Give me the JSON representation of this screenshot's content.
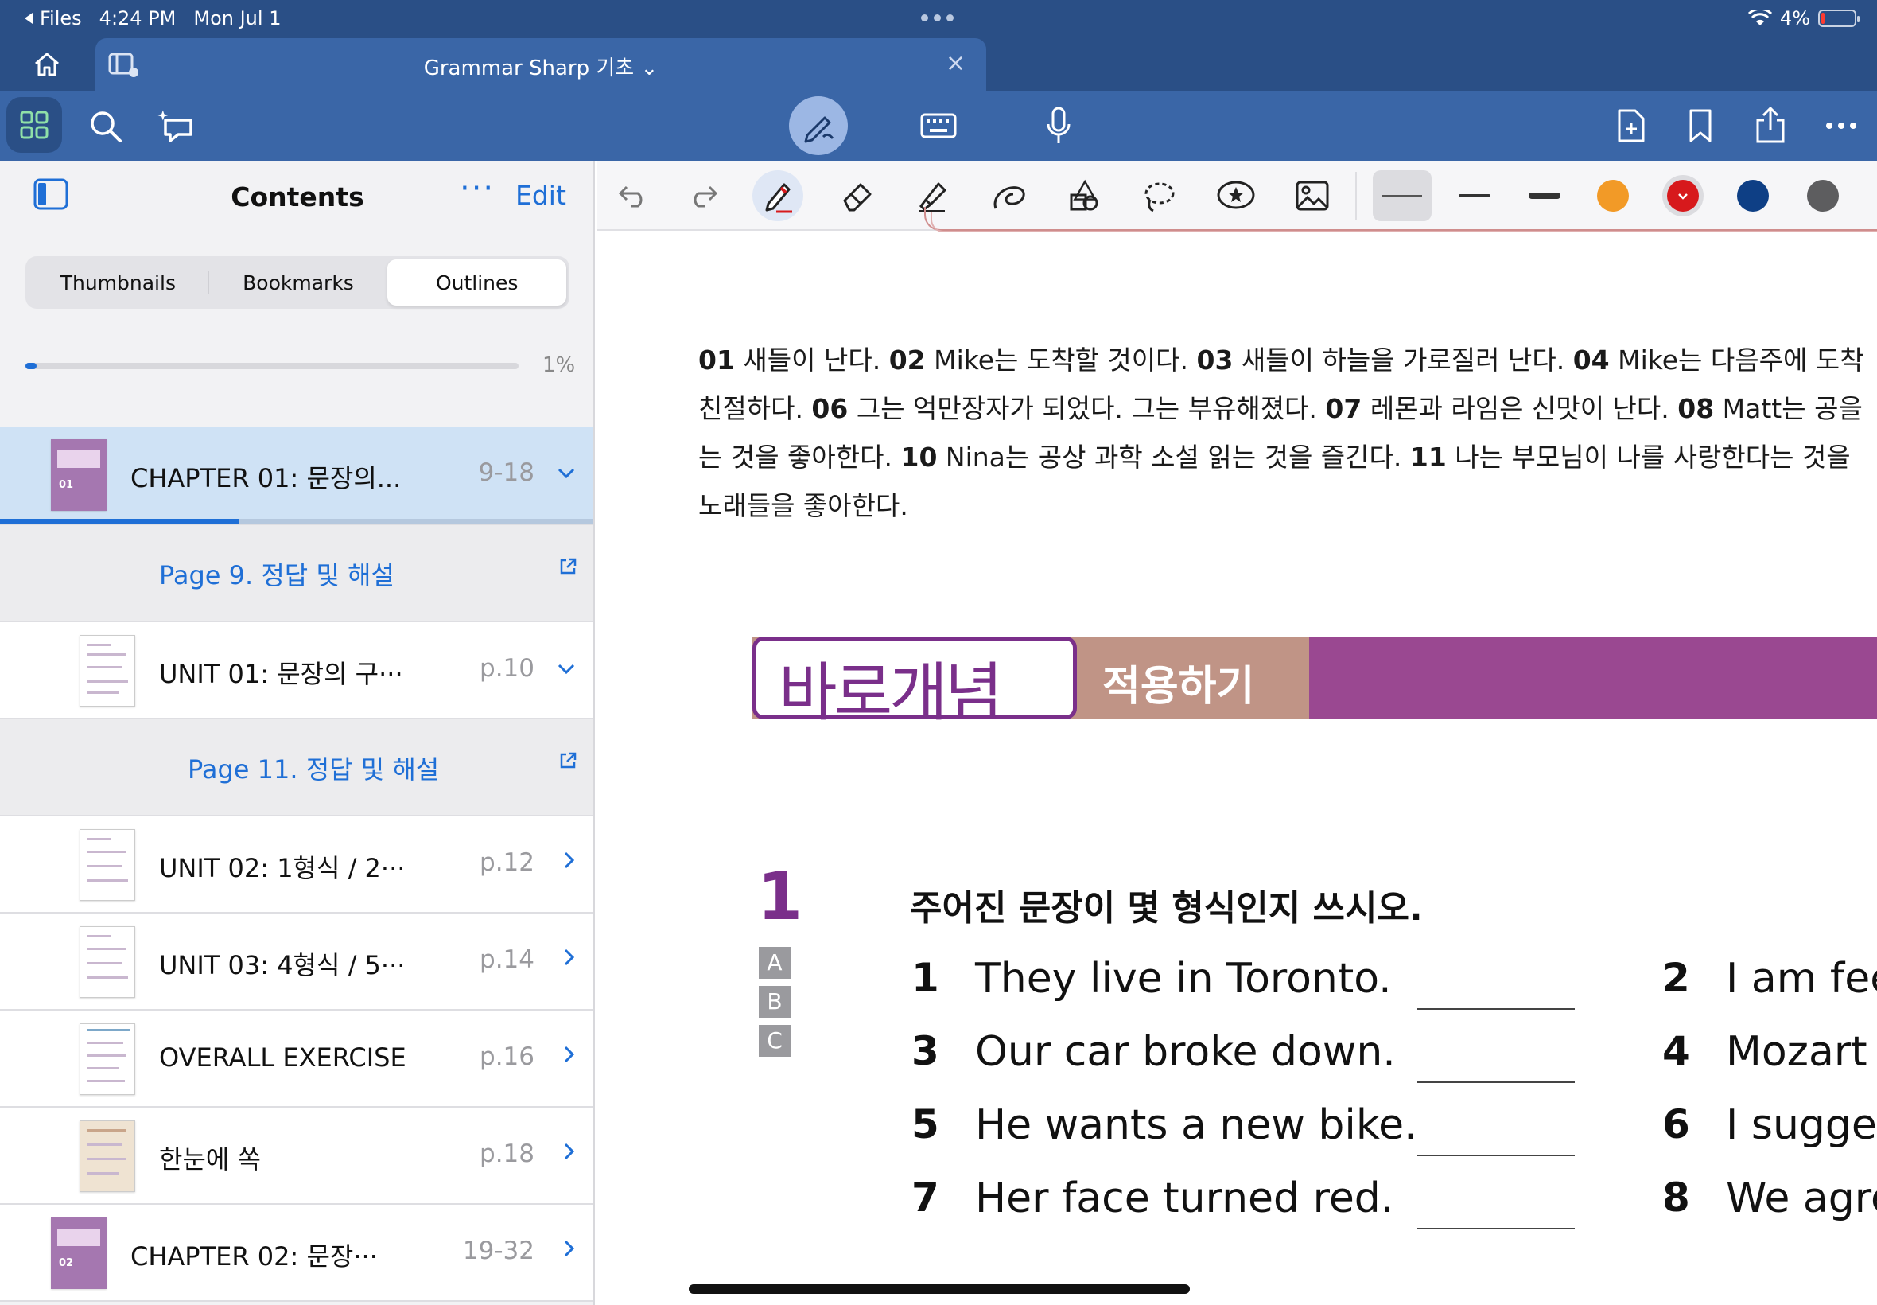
{
  "status_bar": {
    "back_label": "Files",
    "time": "4:24 PM",
    "date": "Mon Jul 1",
    "battery": "4%"
  },
  "tab": {
    "title": "Grammar Sharp 기초 ⌄",
    "close": "×"
  },
  "toolbar": {
    "icons": [
      "home-icon",
      "tab-overview-icon",
      "grid-icon",
      "search-icon",
      "ask-ai-icon",
      "pen-mode-icon",
      "keyboard-icon",
      "microphone-icon",
      "add-page-icon",
      "bookmark-icon",
      "share-icon",
      "more-icon"
    ]
  },
  "sidebar": {
    "title": "Contents",
    "more": "···",
    "edit": "Edit",
    "tabs": [
      "Thumbnails",
      "Bookmarks",
      "Outlines"
    ],
    "active_tab": "Outlines",
    "progress_label": "1%",
    "progress_fraction": 0.01,
    "items": [
      {
        "label": "CHAPTER 01: 문장의...",
        "page": "9-18",
        "kind": "chapter",
        "expanded": true,
        "selected": true
      },
      {
        "label": "Page 9. 정답 및 해설",
        "kind": "link"
      },
      {
        "label": "UNIT 01: 문장의 구···",
        "page": "p.10",
        "kind": "unit",
        "expanded": true
      },
      {
        "label": "Page 11. 정답 및 해설",
        "kind": "link"
      },
      {
        "label": "UNIT 02: 1형식 / 2···",
        "page": "p.12",
        "kind": "unit"
      },
      {
        "label": "UNIT 03: 4형식 / 5···",
        "page": "p.14",
        "kind": "unit"
      },
      {
        "label": "OVERALL EXERCISE",
        "page": "p.16",
        "kind": "unit"
      },
      {
        "label": "한눈에 쏙",
        "page": "p.18",
        "kind": "unit"
      },
      {
        "label": "CHAPTER 02: 문장···",
        "page": "19-32",
        "kind": "chapter"
      }
    ]
  },
  "annotation_bar": {
    "tools": [
      "undo-icon",
      "redo-icon",
      "pen-icon",
      "eraser-icon",
      "highlighter-icon",
      "shape-icon",
      "shapes-lasso-icon",
      "lasso-icon",
      "sticker-icon",
      "image-icon"
    ],
    "colors": [
      "#f29a27",
      "#d7191c",
      "#0e3f85",
      "#5d5d5f"
    ],
    "selected_color": "#d7191c"
  },
  "document": {
    "answer_key": [
      {
        "n": "01",
        "t": " 새들이 난다.   "
      },
      {
        "n": "02",
        "t": " Mike는 도착할 것이다.   "
      },
      {
        "n": "03",
        "t": " 새들이 하늘을 가로질러 난다.   "
      },
      {
        "n": "04",
        "t": " Mike는 다음주에 도착"
      },
      {
        "n": "",
        "t": "친절하다.   "
      },
      {
        "n": "06",
        "t": " 그는 억만장자가 되었다. 그는 부유해졌다.   "
      },
      {
        "n": "07",
        "t": " 레몬과 라임은 신맛이 난다.   "
      },
      {
        "n": "08",
        "t": " Matt는 공을"
      },
      {
        "n": "",
        "t": "는 것을 좋아한다.   "
      },
      {
        "n": "10",
        "t": " Nina는 공상 과학 소설 읽는 것을 즐긴다.   "
      },
      {
        "n": "11",
        "t": " 나는 부모님이 나를 사랑한다는 것을"
      },
      {
        "n": "",
        "t": "노래들을 좋아한다."
      }
    ],
    "banner_title": "바로개념",
    "banner_sub": "적용하기",
    "question_number": "1",
    "instruction": "주어진 문장이 몇 형식인지 쓰시오.",
    "levels": [
      "A",
      "B",
      "C"
    ],
    "items": [
      {
        "n": "1",
        "text": "They live in Toronto."
      },
      {
        "n": "2",
        "text": "I am feel"
      },
      {
        "n": "3",
        "text": "Our car broke down."
      },
      {
        "n": "4",
        "text": "Mozart w"
      },
      {
        "n": "5",
        "text": "He wants a new bike."
      },
      {
        "n": "6",
        "text": "I sugges"
      },
      {
        "n": "7",
        "text": "Her face turned red."
      },
      {
        "n": "8",
        "text": "We agre"
      }
    ]
  }
}
